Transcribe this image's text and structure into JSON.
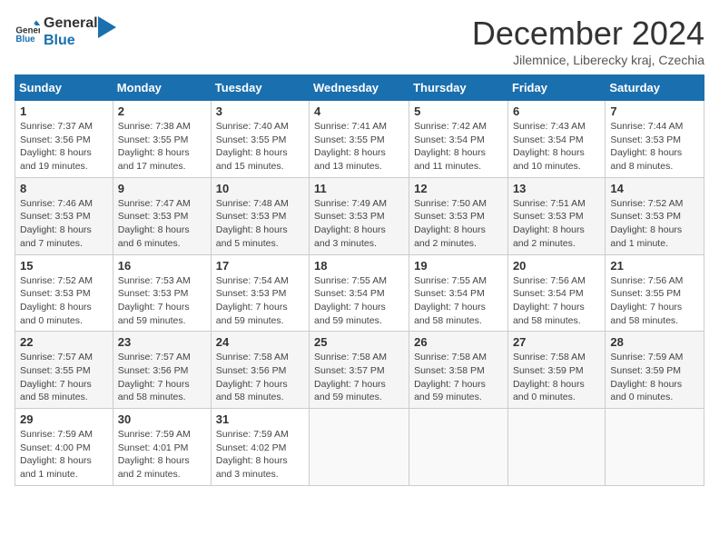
{
  "logo": {
    "line1": "General",
    "line2": "Blue"
  },
  "title": "December 2024",
  "location": "Jilemnice, Liberecky kraj, Czechia",
  "weekdays": [
    "Sunday",
    "Monday",
    "Tuesday",
    "Wednesday",
    "Thursday",
    "Friday",
    "Saturday"
  ],
  "weeks": [
    [
      {
        "day": "1",
        "detail": "Sunrise: 7:37 AM\nSunset: 3:56 PM\nDaylight: 8 hours\nand 19 minutes."
      },
      {
        "day": "2",
        "detail": "Sunrise: 7:38 AM\nSunset: 3:55 PM\nDaylight: 8 hours\nand 17 minutes."
      },
      {
        "day": "3",
        "detail": "Sunrise: 7:40 AM\nSunset: 3:55 PM\nDaylight: 8 hours\nand 15 minutes."
      },
      {
        "day": "4",
        "detail": "Sunrise: 7:41 AM\nSunset: 3:55 PM\nDaylight: 8 hours\nand 13 minutes."
      },
      {
        "day": "5",
        "detail": "Sunrise: 7:42 AM\nSunset: 3:54 PM\nDaylight: 8 hours\nand 11 minutes."
      },
      {
        "day": "6",
        "detail": "Sunrise: 7:43 AM\nSunset: 3:54 PM\nDaylight: 8 hours\nand 10 minutes."
      },
      {
        "day": "7",
        "detail": "Sunrise: 7:44 AM\nSunset: 3:53 PM\nDaylight: 8 hours\nand 8 minutes."
      }
    ],
    [
      {
        "day": "8",
        "detail": "Sunrise: 7:46 AM\nSunset: 3:53 PM\nDaylight: 8 hours\nand 7 minutes."
      },
      {
        "day": "9",
        "detail": "Sunrise: 7:47 AM\nSunset: 3:53 PM\nDaylight: 8 hours\nand 6 minutes."
      },
      {
        "day": "10",
        "detail": "Sunrise: 7:48 AM\nSunset: 3:53 PM\nDaylight: 8 hours\nand 5 minutes."
      },
      {
        "day": "11",
        "detail": "Sunrise: 7:49 AM\nSunset: 3:53 PM\nDaylight: 8 hours\nand 3 minutes."
      },
      {
        "day": "12",
        "detail": "Sunrise: 7:50 AM\nSunset: 3:53 PM\nDaylight: 8 hours\nand 2 minutes."
      },
      {
        "day": "13",
        "detail": "Sunrise: 7:51 AM\nSunset: 3:53 PM\nDaylight: 8 hours\nand 2 minutes."
      },
      {
        "day": "14",
        "detail": "Sunrise: 7:52 AM\nSunset: 3:53 PM\nDaylight: 8 hours\nand 1 minute."
      }
    ],
    [
      {
        "day": "15",
        "detail": "Sunrise: 7:52 AM\nSunset: 3:53 PM\nDaylight: 8 hours\nand 0 minutes."
      },
      {
        "day": "16",
        "detail": "Sunrise: 7:53 AM\nSunset: 3:53 PM\nDaylight: 7 hours\nand 59 minutes."
      },
      {
        "day": "17",
        "detail": "Sunrise: 7:54 AM\nSunset: 3:53 PM\nDaylight: 7 hours\nand 59 minutes."
      },
      {
        "day": "18",
        "detail": "Sunrise: 7:55 AM\nSunset: 3:54 PM\nDaylight: 7 hours\nand 59 minutes."
      },
      {
        "day": "19",
        "detail": "Sunrise: 7:55 AM\nSunset: 3:54 PM\nDaylight: 7 hours\nand 58 minutes."
      },
      {
        "day": "20",
        "detail": "Sunrise: 7:56 AM\nSunset: 3:54 PM\nDaylight: 7 hours\nand 58 minutes."
      },
      {
        "day": "21",
        "detail": "Sunrise: 7:56 AM\nSunset: 3:55 PM\nDaylight: 7 hours\nand 58 minutes."
      }
    ],
    [
      {
        "day": "22",
        "detail": "Sunrise: 7:57 AM\nSunset: 3:55 PM\nDaylight: 7 hours\nand 58 minutes."
      },
      {
        "day": "23",
        "detail": "Sunrise: 7:57 AM\nSunset: 3:56 PM\nDaylight: 7 hours\nand 58 minutes."
      },
      {
        "day": "24",
        "detail": "Sunrise: 7:58 AM\nSunset: 3:56 PM\nDaylight: 7 hours\nand 58 minutes."
      },
      {
        "day": "25",
        "detail": "Sunrise: 7:58 AM\nSunset: 3:57 PM\nDaylight: 7 hours\nand 59 minutes."
      },
      {
        "day": "26",
        "detail": "Sunrise: 7:58 AM\nSunset: 3:58 PM\nDaylight: 7 hours\nand 59 minutes."
      },
      {
        "day": "27",
        "detail": "Sunrise: 7:58 AM\nSunset: 3:59 PM\nDaylight: 8 hours\nand 0 minutes."
      },
      {
        "day": "28",
        "detail": "Sunrise: 7:59 AM\nSunset: 3:59 PM\nDaylight: 8 hours\nand 0 minutes."
      }
    ],
    [
      {
        "day": "29",
        "detail": "Sunrise: 7:59 AM\nSunset: 4:00 PM\nDaylight: 8 hours\nand 1 minute."
      },
      {
        "day": "30",
        "detail": "Sunrise: 7:59 AM\nSunset: 4:01 PM\nDaylight: 8 hours\nand 2 minutes."
      },
      {
        "day": "31",
        "detail": "Sunrise: 7:59 AM\nSunset: 4:02 PM\nDaylight: 8 hours\nand 3 minutes."
      },
      null,
      null,
      null,
      null
    ]
  ]
}
